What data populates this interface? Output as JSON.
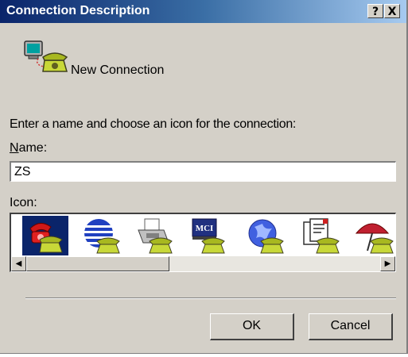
{
  "window": {
    "title": "Connection Description",
    "help_label": "?",
    "close_label": "X"
  },
  "header": {
    "icon": "new-connection-icon",
    "label": "New Connection"
  },
  "instructions": "Enter a name and choose an icon for the connection:",
  "name_field": {
    "label_mnemonic": "N",
    "label_rest": "ame:",
    "value": "ZS"
  },
  "icon_picker": {
    "label": "Icon:",
    "icons": [
      {
        "name": "red-telephone-icon",
        "selected": true
      },
      {
        "name": "globe-icon",
        "selected": false
      },
      {
        "name": "fax-machine-icon",
        "selected": false
      },
      {
        "name": "mci-icon",
        "selected": false
      },
      {
        "name": "blue-world-icon",
        "selected": false
      },
      {
        "name": "documents-icon",
        "selected": false
      },
      {
        "name": "umbrella-icon",
        "selected": false
      }
    ],
    "mci_text": "MCI"
  },
  "buttons": {
    "ok": "OK",
    "cancel": "Cancel"
  },
  "colors": {
    "title_bar": "#0a246a",
    "dialog_face": "#d4d0c8",
    "selection": "#0a246a"
  }
}
